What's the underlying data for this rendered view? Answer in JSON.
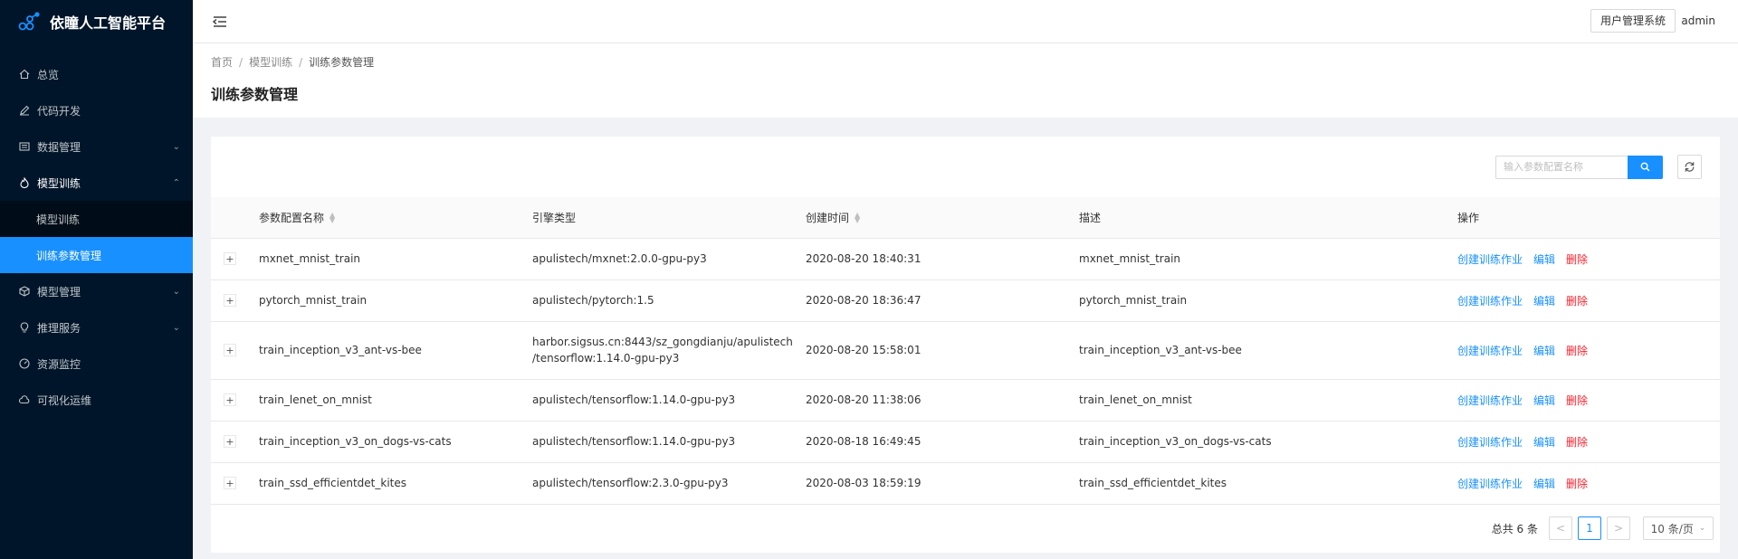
{
  "app": {
    "title": "依瞳人工智能平台"
  },
  "sidebar": {
    "items": [
      {
        "label": "总览",
        "icon": "home-icon",
        "chevron": ""
      },
      {
        "label": "代码开发",
        "icon": "edit-icon",
        "chevron": ""
      },
      {
        "label": "数据管理",
        "icon": "database-icon",
        "chevron": "⌄"
      },
      {
        "label": "模型训练",
        "icon": "fire-icon",
        "chevron": "⌃"
      }
    ],
    "submenu": [
      {
        "label": "模型训练"
      },
      {
        "label": "训练参数管理"
      }
    ],
    "items_after": [
      {
        "label": "模型管理",
        "icon": "model-icon",
        "chevron": "⌄"
      },
      {
        "label": "推理服务",
        "icon": "bulb-icon",
        "chevron": "⌄"
      },
      {
        "label": "资源监控",
        "icon": "dashboard-icon",
        "chevron": ""
      },
      {
        "label": "可视化运维",
        "icon": "cloud-icon",
        "chevron": ""
      }
    ]
  },
  "header": {
    "user_mgmt_label": "用户管理系统",
    "username": "admin"
  },
  "breadcrumb": {
    "home": "首页",
    "sep": "/",
    "parent": "模型训练",
    "current": "训练参数管理"
  },
  "page": {
    "title": "训练参数管理"
  },
  "search": {
    "placeholder": "输入参数配置名称"
  },
  "table": {
    "headers": {
      "name": "参数配置名称",
      "engine": "引擎类型",
      "time": "创建时间",
      "desc": "描述",
      "ops": "操作"
    },
    "rows": [
      {
        "name": "mxnet_mnist_train",
        "engine1": "apulistech/mxnet:2.0.0-gpu-py3",
        "engine2": "",
        "time": "2020-08-20 18:40:31",
        "desc": "mxnet_mnist_train"
      },
      {
        "name": "pytorch_mnist_train",
        "engine1": "apulistech/pytorch:1.5",
        "engine2": "",
        "time": "2020-08-20 18:36:47",
        "desc": "pytorch_mnist_train"
      },
      {
        "name": "train_inception_v3_ant-vs-bee",
        "engine1": "harbor.sigsus.cn:8443/sz_gongdianju/apulistech",
        "engine2": "/tensorflow:1.14.0-gpu-py3",
        "time": "2020-08-20 15:58:01",
        "desc": "train_inception_v3_ant-vs-bee"
      },
      {
        "name": "train_lenet_on_mnist",
        "engine1": "apulistech/tensorflow:1.14.0-gpu-py3",
        "engine2": "",
        "time": "2020-08-20 11:38:06",
        "desc": "train_lenet_on_mnist"
      },
      {
        "name": "train_inception_v3_on_dogs-vs-cats",
        "engine1": "apulistech/tensorflow:1.14.0-gpu-py3",
        "engine2": "",
        "time": "2020-08-18 16:49:45",
        "desc": "train_inception_v3_on_dogs-vs-cats"
      },
      {
        "name": "train_ssd_efficientdet_kites",
        "engine1": "apulistech/tensorflow:2.3.0-gpu-py3",
        "engine2": "",
        "time": "2020-08-03 18:59:19",
        "desc": "train_ssd_efficientdet_kites"
      }
    ],
    "ops": {
      "create": "创建训练作业",
      "edit": "编辑",
      "delete": "删除"
    },
    "expand": "+"
  },
  "pagination": {
    "total": "总共 6 条",
    "prev": "<",
    "current_page": "1",
    "next": ">",
    "page_size": "10 条/页"
  },
  "colors": {
    "accent": "#1890ff",
    "danger": "#f5222d",
    "sidebar_bg": "#001529"
  }
}
